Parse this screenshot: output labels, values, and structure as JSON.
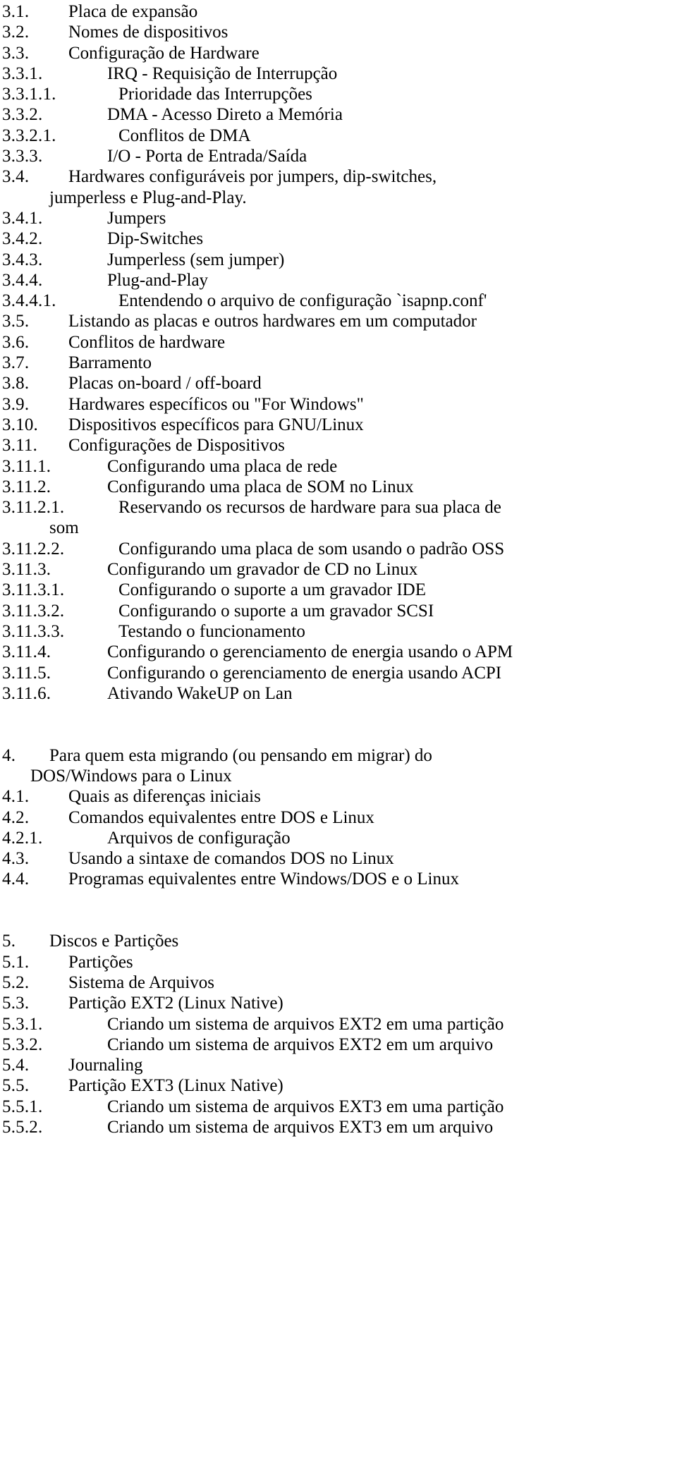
{
  "document": {
    "language": "pt-BR",
    "kind": "table-of-contents",
    "background_color": "#ffffff",
    "text_color": "#000000"
  },
  "entries": [
    {
      "number": "3.1.",
      "title": "Placa de expansão",
      "level": 2
    },
    {
      "number": "3.2.",
      "title": "Nomes de dispositivos",
      "level": 2
    },
    {
      "number": "3.3.",
      "title": "Configuração de Hardware",
      "level": 2
    },
    {
      "number": "3.3.1.",
      "title": "IRQ - Requisição de Interrupção",
      "level": 3
    },
    {
      "number": "3.3.1.1.",
      "title": "Prioridade das Interrupções",
      "level": 4
    },
    {
      "number": "3.3.2.",
      "title": "DMA - Acesso Direto a Memória",
      "level": 3
    },
    {
      "number": "3.3.2.1.",
      "title": "Conflitos de DMA",
      "level": 4
    },
    {
      "number": "3.3.3.",
      "title": "I/O - Porta de Entrada/Saída",
      "level": 3
    },
    {
      "number": "3.4.",
      "title": "Hardwares configuráveis por jumpers, dip-switches,",
      "title_cont": "jumperless e Plug-and-Play.",
      "level": 2,
      "wraps": true
    },
    {
      "number": "3.4.1.",
      "title": "Jumpers",
      "level": 3
    },
    {
      "number": "3.4.2.",
      "title": "Dip-Switches",
      "level": 3
    },
    {
      "number": "3.4.3.",
      "title": "Jumperless (sem jumper)",
      "level": 3
    },
    {
      "number": "3.4.4.",
      "title": "Plug-and-Play",
      "level": 3
    },
    {
      "number": "3.4.4.1.",
      "title": "Entendendo o arquivo de configuração `isapnp.conf'",
      "level": 4
    },
    {
      "number": "3.5.",
      "title": "Listando as placas e outros hardwares em um computador",
      "level": 2
    },
    {
      "number": "3.6.",
      "title": "Conflitos de hardware",
      "level": 2
    },
    {
      "number": "3.7.",
      "title": "Barramento",
      "level": 2
    },
    {
      "number": "3.8.",
      "title": "Placas on-board / off-board",
      "level": 2
    },
    {
      "number": "3.9.",
      "title": "Hardwares específicos ou \"For Windows\"",
      "level": 2
    },
    {
      "number": "3.10.",
      "title": "Dispositivos específicos para GNU/Linux",
      "level": 2
    },
    {
      "number": "3.11.",
      "title": "Configurações de Dispositivos",
      "level": 2
    },
    {
      "number": "3.11.1.",
      "title": "Configurando uma placa de rede",
      "level": 3
    },
    {
      "number": "3.11.2.",
      "title": "Configurando uma placa de SOM no Linux",
      "level": 3
    },
    {
      "number": "3.11.2.1.",
      "title": "Reservando os recursos de hardware para sua placa de",
      "title_cont": "som",
      "level": 4,
      "wraps": true
    },
    {
      "number": "3.11.2.2.",
      "title": "Configurando uma placa de som usando o padrão OSS",
      "level": 4
    },
    {
      "number": "3.11.3.",
      "title": "Configurando um gravador de CD no Linux",
      "level": 3
    },
    {
      "number": "3.11.3.1.",
      "title": "Configurando o suporte a um gravador IDE",
      "level": 4
    },
    {
      "number": "3.11.3.2.",
      "title": "Configurando o suporte a um gravador SCSI",
      "level": 4
    },
    {
      "number": "3.11.3.3.",
      "title": "Testando o funcionamento",
      "level": 4
    },
    {
      "number": "3.11.4.",
      "title": "Configurando o gerenciamento de energia usando o APM",
      "level": 3
    },
    {
      "number": "3.11.5.",
      "title": "Configurando o gerenciamento de energia usando ACPI",
      "level": 3
    },
    {
      "number": "3.11.6.",
      "title": "Ativando WakeUP on Lan",
      "level": 3
    },
    {
      "spacer": true
    },
    {
      "spacer": true
    },
    {
      "number": "4.",
      "title": "Para quem esta migrando (ou pensando em migrar) do",
      "title_cont": "DOS/Windows para o Linux",
      "level": 1,
      "wraps": true
    },
    {
      "number": "4.1.",
      "title": "Quais as diferenças iniciais",
      "level": 2
    },
    {
      "number": "4.2.",
      "title": "Comandos equivalentes entre DOS e Linux",
      "level": 2
    },
    {
      "number": "4.2.1.",
      "title": "Arquivos de configuração",
      "level": 3
    },
    {
      "number": "4.3.",
      "title": "Usando a sintaxe de comandos DOS no Linux",
      "level": 2
    },
    {
      "number": "4.4.",
      "title": "Programas equivalentes entre Windows/DOS e o Linux",
      "level": 2
    },
    {
      "spacer": true
    },
    {
      "spacer": true
    },
    {
      "number": "5.",
      "title": "Discos e Partições",
      "level": 1
    },
    {
      "number": "5.1.",
      "title": "Partições",
      "level": 2
    },
    {
      "number": "5.2.",
      "title": "Sistema de Arquivos",
      "level": 2
    },
    {
      "number": "5.3.",
      "title": "Partição EXT2 (Linux Native)",
      "level": 2
    },
    {
      "number": "5.3.1.",
      "title": "Criando um sistema de arquivos EXT2 em uma partição",
      "level": 3
    },
    {
      "number": "5.3.2.",
      "title": "Criando um sistema de arquivos EXT2 em um arquivo",
      "level": 3
    },
    {
      "number": "5.4.",
      "title": "Journaling",
      "level": 2
    },
    {
      "number": "5.5.",
      "title": "Partição EXT3 (Linux Native)",
      "level": 2
    },
    {
      "number": "5.5.1.",
      "title": "Criando um sistema de arquivos EXT3 em uma partição",
      "level": 3
    },
    {
      "number": "5.5.2.",
      "title": "Criando um sistema de arquivos EXT3 em um arquivo",
      "level": 3
    }
  ]
}
